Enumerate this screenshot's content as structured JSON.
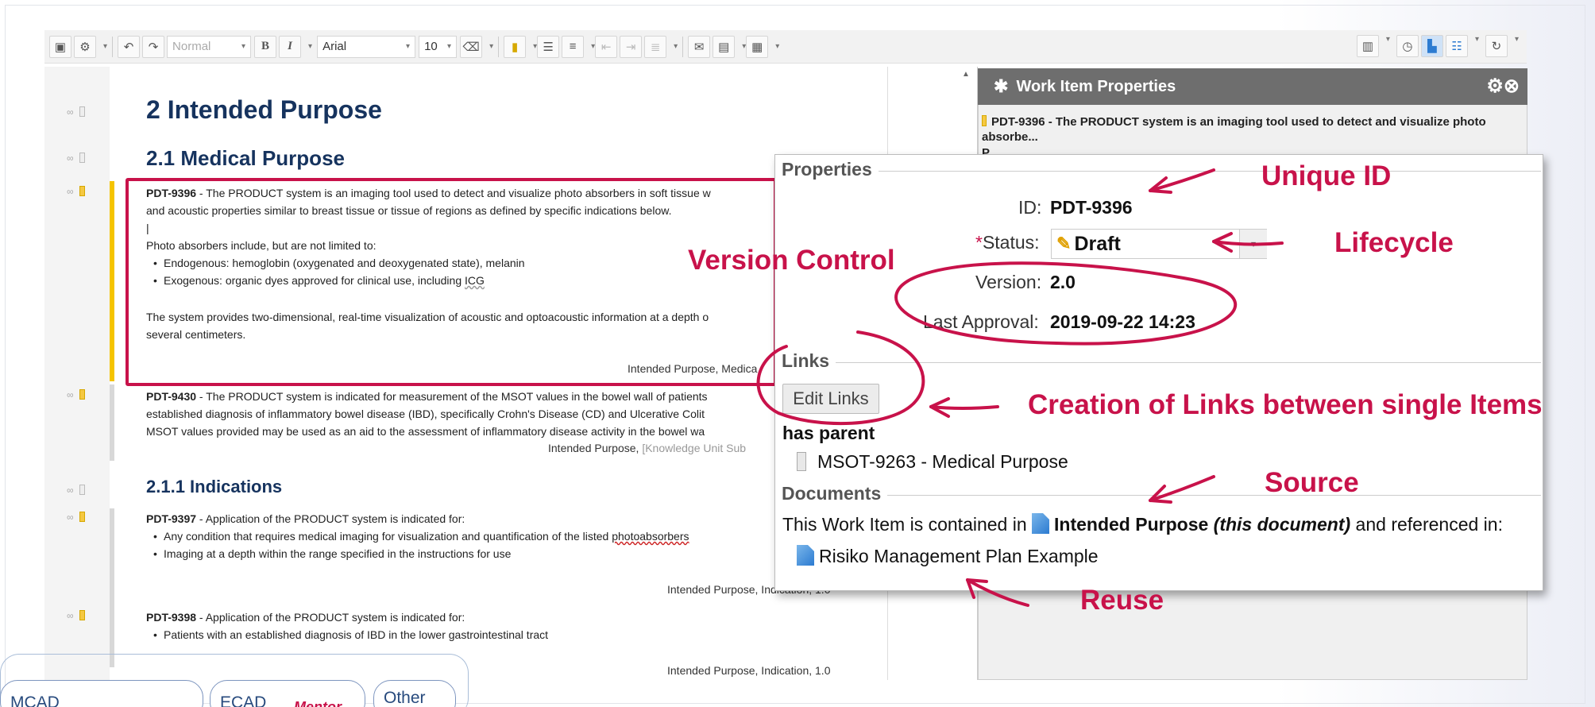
{
  "toolbar": {
    "style_value": "Normal",
    "bold_label": "B",
    "italic_label": "I",
    "font_value": "Arial",
    "size_value": "10"
  },
  "doc": {
    "h1": "2 Intended Purpose",
    "h2": "2.1 Medical Purpose",
    "item1": {
      "id": "PDT-9396",
      "line1": " - The PRODUCT system is an imaging tool used to detect and visualize photo absorbers in soft tissue w",
      "line2": "and acoustic properties similar to breast tissue or tissue of regions as defined by specific indications below.",
      "cursor": "|",
      "line3": "Photo absorbers include, but are not limited to:",
      "bullet1": "Endogenous: hemoglobin (oxygenated and deoxygenated state), melanin",
      "bullet2_pre": "Exogenous: organic dyes approved for clinical use, including ",
      "bullet2_icg": "ICG",
      "line4": "The system provides two-dimensional, real-time visualization of acoustic and optoacoustic information at a depth o",
      "line5": "several centimeters.",
      "meta": "Intended Purpose, Medica"
    },
    "item2": {
      "id": "PDT-9430",
      "line1": " - The PRODUCT system is indicated for measurement of the MSOT values in the bowel wall of patients",
      "line2": "established diagnosis of inflammatory bowel disease (IBD), specifically Crohn's Disease (CD) and Ulcerative Colit",
      "line3": "MSOT values provided may be used as an aid to the assessment of inflammatory disease activity in the bowel wa",
      "meta": "Intended Purpose, ",
      "meta_gray": "[Knowledge Unit Sub"
    },
    "h3": "2.1.1 Indications",
    "item3": {
      "id": "PDT-9397",
      "line1": " - Application of the PRODUCT system is indicated for:",
      "bullet1_pre": "Any condition that requires medical imaging for visualization and quantification of the listed ",
      "bullet1_word": "photoabsorbers",
      "bullet2": "Imaging at a depth within the range specified in the instructions for use",
      "meta": "Intended Purpose, Indication, 1.0"
    },
    "item4": {
      "id": "PDT-9398",
      "line1": " - Application of the PRODUCT system is indicated for:",
      "bullet1": "Patients with an established diagnosis of IBD in the lower gastrointestinal tract",
      "meta": "Intended Purpose, Indication, 1.0"
    }
  },
  "side_panel": {
    "title": "Work Item Properties",
    "subtitle": "PDT-9396 - The PRODUCT system is an imaging tool used to detect and visualize photo absorbe...",
    "subtitle_cut": "P..."
  },
  "popup": {
    "properties_heading": "Properties",
    "id_label": "ID:",
    "id_value": "PDT-9396",
    "status_req": "*",
    "status_label": "Status:",
    "status_value": "Draft",
    "version_label": "Version:",
    "version_value": "2.0",
    "approval_label": "Last Approval:",
    "approval_value": "2019-09-22 14:23",
    "links_heading": "Links",
    "edit_links_label": "Edit Links",
    "has_parent_label": "has parent",
    "parent_item": "MSOT-9263 - Medical Purpose",
    "documents_heading": "Documents",
    "contained_pre": "This Work Item is contained in ",
    "contained_doc": "Intended Purpose",
    "contained_note": " (this document)",
    "contained_post": " and referenced in:",
    "referenced_doc": "Risiko Management Plan Example"
  },
  "annotations": {
    "unique_id": "Unique ID",
    "lifecycle": "Lifecycle",
    "version_control": "Version Control",
    "links": "Creation of Links between single Items",
    "source": "Source",
    "reuse": "Reuse"
  },
  "bottom_tabs": {
    "tab1": "MCAD",
    "tab2": "ECAD",
    "tab3": "Other",
    "logo_text": "Mentor"
  },
  "colors": {
    "annotation": "#c8124a",
    "heading": "#16335e",
    "panel_header": "#6e6e6e",
    "status_bar": "#f5c400"
  }
}
